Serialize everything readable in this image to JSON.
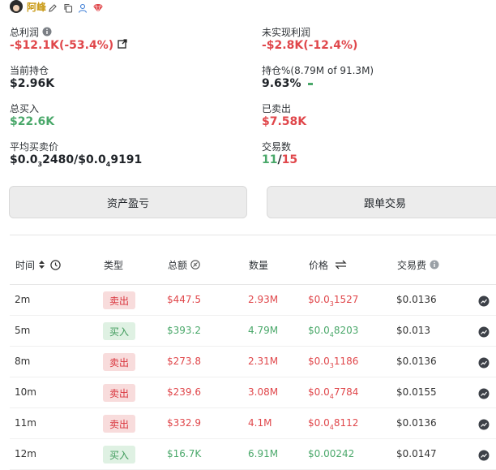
{
  "header": {
    "username": "阿峰"
  },
  "stats": {
    "total_profit": {
      "label": "总利润",
      "value": "-$12.1K(-53.4%)"
    },
    "unrealized_profit": {
      "label": "未实现利润",
      "value": "-$2.8K(-12.4%)"
    },
    "current_holding": {
      "label": "当前持仓",
      "value": "$2.96K"
    },
    "holding_pct": {
      "label": "持仓%(8.79M of 91.3M)",
      "value": "9.63%"
    },
    "total_bought": {
      "label": "总买入",
      "value": "$22.6K"
    },
    "sold": {
      "label": "已卖出",
      "value": "$7.58K"
    },
    "avg_price": {
      "label": "平均买卖价",
      "buy_prefix": "$0.0",
      "buy_sub": "3",
      "buy_rest": "2480/$0.0",
      "sell_sub": "4",
      "sell_rest": "9191"
    },
    "trades": {
      "label": "交易数",
      "sells": "11",
      "sep": "/",
      "total": "15"
    }
  },
  "buttons": {
    "asset_pnl": "资产盈亏",
    "copy_trade": "跟单交易"
  },
  "table": {
    "headers": {
      "time": "时间",
      "type": "类型",
      "amount": "总额",
      "quantity": "数量",
      "price": "价格",
      "fee": "交易费"
    },
    "rows": [
      {
        "time": "2m",
        "type": "卖出",
        "side": "sell",
        "amount": "$447.5",
        "quantity": "2.93M",
        "price_prefix": "$0.0",
        "price_sub": "3",
        "price_rest": "1527",
        "fee": "$0.0136"
      },
      {
        "time": "5m",
        "type": "买入",
        "side": "buy",
        "amount": "$393.2",
        "quantity": "4.79M",
        "price_prefix": "$0.0",
        "price_sub": "4",
        "price_rest": "8203",
        "fee": "$0.013"
      },
      {
        "time": "8m",
        "type": "卖出",
        "side": "sell",
        "amount": "$273.8",
        "quantity": "2.31M",
        "price_prefix": "$0.0",
        "price_sub": "3",
        "price_rest": "1186",
        "fee": "$0.0136"
      },
      {
        "time": "10m",
        "type": "卖出",
        "side": "sell",
        "amount": "$239.6",
        "quantity": "3.08M",
        "price_prefix": "$0.0",
        "price_sub": "4",
        "price_rest": "7784",
        "fee": "$0.0155"
      },
      {
        "time": "11m",
        "type": "卖出",
        "side": "sell",
        "amount": "$332.9",
        "quantity": "4.1M",
        "price_prefix": "$0.0",
        "price_sub": "4",
        "price_rest": "8112",
        "fee": "$0.0136"
      },
      {
        "time": "12m",
        "type": "买入",
        "side": "buy",
        "amount": "$16.7K",
        "quantity": "6.91M",
        "price_prefix": "$0.00242",
        "price_sub": "",
        "price_rest": "",
        "fee": "$0.0147"
      }
    ]
  },
  "colors": {
    "red": "#e0474b",
    "green": "#4aa86a",
    "username": "#c99a16"
  }
}
